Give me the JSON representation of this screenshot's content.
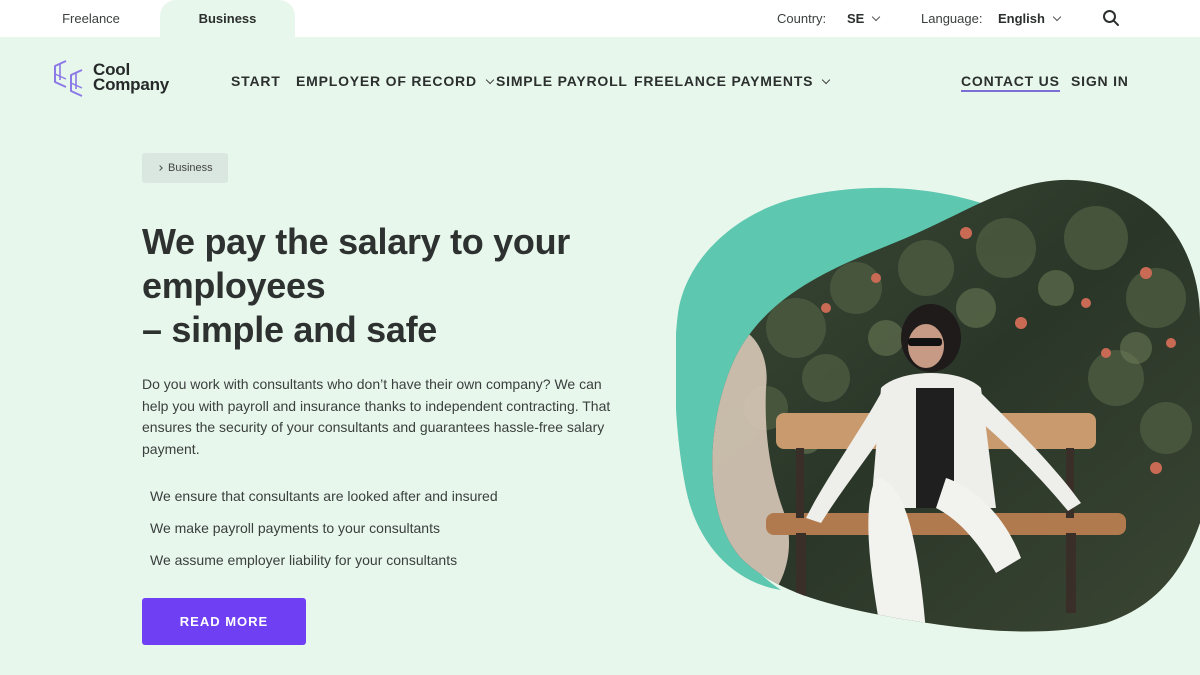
{
  "topbar": {
    "segments": [
      {
        "label": "Freelance",
        "active": false
      },
      {
        "label": "Business",
        "active": true
      }
    ],
    "country_label": "Country:",
    "country_value": "SE",
    "language_label": "Language:",
    "language_value": "English",
    "search_icon": "search-icon"
  },
  "logo": {
    "line1": "Cool",
    "line2": "Company"
  },
  "nav": {
    "items": [
      {
        "label": "START",
        "has_dropdown": false
      },
      {
        "label": "EMPLOYER OF RECORD",
        "has_dropdown": true
      },
      {
        "label": "SIMPLE PAYROLL",
        "has_dropdown": false
      },
      {
        "label": "FREELANCE PAYMENTS",
        "has_dropdown": true
      }
    ],
    "contact": "CONTACT US",
    "sign_in": "SIGN IN"
  },
  "breadcrumb": {
    "label": "Business"
  },
  "hero": {
    "title_lines": [
      "We pay the salary to your",
      "employees",
      "– simple and safe"
    ],
    "description": "Do you work with consultants who don’t have their own company? We can help you with payroll and insurance thanks to independent contracting. That ensures the security of your consultants and guarantees hassle-free salary payment.",
    "bullets": [
      "We ensure that consultants are looked after and insured",
      "We make payroll payments to your consultants",
      "We assume employer liability for your consultants"
    ],
    "cta": "READ MORE"
  },
  "colors": {
    "background": "#e8f7ec",
    "accent": "#6e3ff3",
    "blob": "#5dc7b0",
    "contact_underline": "#7b6fd6"
  }
}
